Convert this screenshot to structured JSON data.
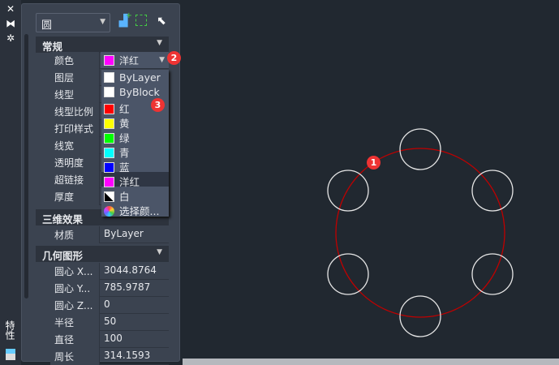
{
  "strip": {
    "close_icon": "✕",
    "pin_icon": "⧓",
    "settings_icon": "✲",
    "title": "特性"
  },
  "object_select": {
    "value": "圆"
  },
  "toolbar": [
    "add-selection-icon",
    "quick-select-icon",
    "pickadd-icon"
  ],
  "sections": {
    "general": {
      "title": "常规",
      "rows": [
        {
          "label": "颜色",
          "value": "洋红"
        },
        {
          "label": "图层",
          "value": ""
        },
        {
          "label": "线型",
          "value": ""
        },
        {
          "label": "线型比例",
          "value": ""
        },
        {
          "label": "打印样式",
          "value": ""
        },
        {
          "label": "线宽",
          "value": ""
        },
        {
          "label": "透明度",
          "value": ""
        },
        {
          "label": "超链接",
          "value": ""
        },
        {
          "label": "厚度",
          "value": ""
        }
      ]
    },
    "threed": {
      "title": "三维效果",
      "rows": [
        {
          "label": "材质",
          "value": "ByLayer"
        }
      ]
    },
    "geometry": {
      "title": "几何图形",
      "rows": [
        {
          "label": "圆心 X...",
          "value": "3044.8764"
        },
        {
          "label": "圆心 Y...",
          "value": "785.9787"
        },
        {
          "label": "圆心 Z...",
          "value": "0"
        },
        {
          "label": "半径",
          "value": "50"
        },
        {
          "label": "直径",
          "value": "100"
        },
        {
          "label": "周长",
          "value": "314.1593"
        }
      ]
    }
  },
  "color_dropdown": {
    "items": [
      {
        "label": "ByLayer",
        "color": "#ffffff"
      },
      {
        "label": "ByBlock",
        "color": "#ffffff"
      },
      {
        "label": "红",
        "color": "#ff0000"
      },
      {
        "label": "黄",
        "color": "#ffff00"
      },
      {
        "label": "绿",
        "color": "#00ff00"
      },
      {
        "label": "青",
        "color": "#00ffff"
      },
      {
        "label": "蓝",
        "color": "#0000ff"
      },
      {
        "label": "洋红",
        "color": "#ff00ff"
      },
      {
        "label": "白",
        "color": "#ffffff"
      },
      {
        "label": "选择颜...",
        "color": "wheel"
      }
    ],
    "selected": "洋红"
  },
  "badges": [
    "1",
    "2",
    "3"
  ],
  "colors": {
    "accent": "#e33333",
    "circle_red": "#c00000",
    "circle_white": "#e6e6e6"
  }
}
